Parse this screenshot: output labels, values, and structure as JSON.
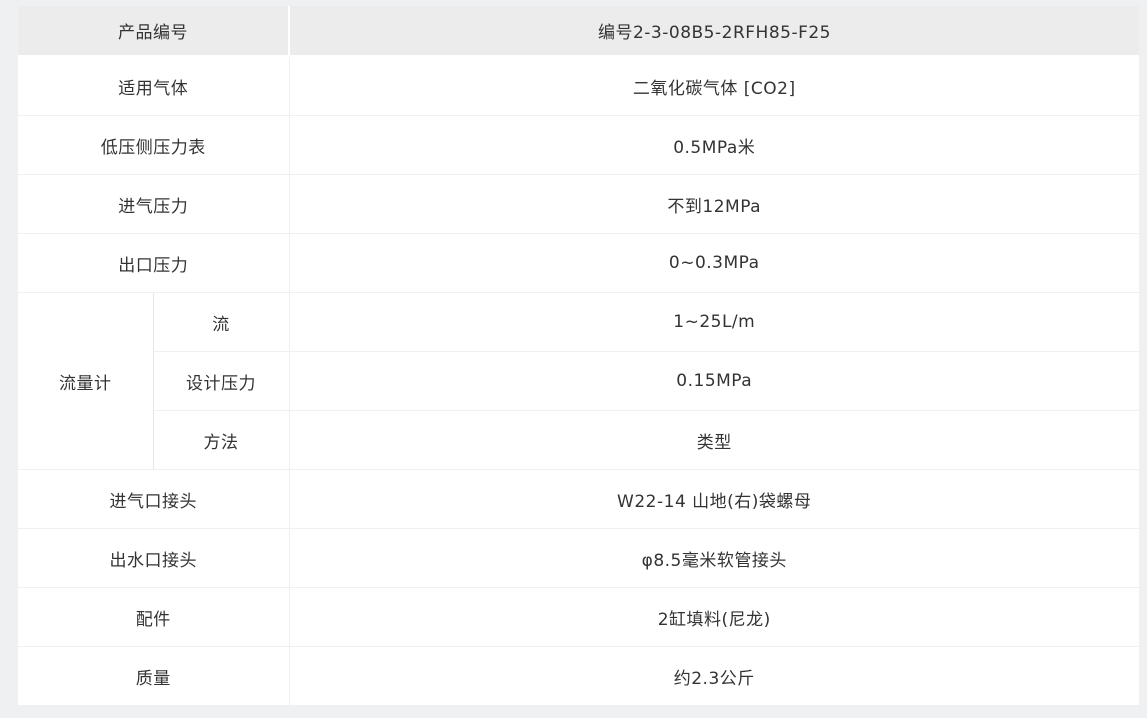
{
  "table": {
    "header": {
      "label": "产品编号",
      "value": "编号2-3-08B5-2RFH85-F25"
    },
    "rows": [
      {
        "label": "适用气体",
        "value": "二氧化碳气体 [CO2]"
      },
      {
        "label": "低压侧压力表",
        "value": "0.5MPa米"
      },
      {
        "label": "进气压力",
        "value": "不到12MPa"
      },
      {
        "label": "出口压力",
        "value": "0~0.3MPa"
      }
    ],
    "flowmeter": {
      "label": "流量计",
      "subrows": [
        {
          "label": "流",
          "value": "1~25L/m"
        },
        {
          "label": "设计压力",
          "value": "0.15MPa"
        },
        {
          "label": "方法",
          "value": "类型"
        }
      ]
    },
    "rows_after": [
      {
        "label": "进气口接头",
        "value": "W22-14 山地(右)袋螺母"
      },
      {
        "label": "出水口接头",
        "value": "φ8.5毫米软管接头"
      },
      {
        "label": "配件",
        "value": "2缸填料(尼龙)"
      },
      {
        "label": "质量",
        "value": "约2.3公斤"
      }
    ]
  }
}
